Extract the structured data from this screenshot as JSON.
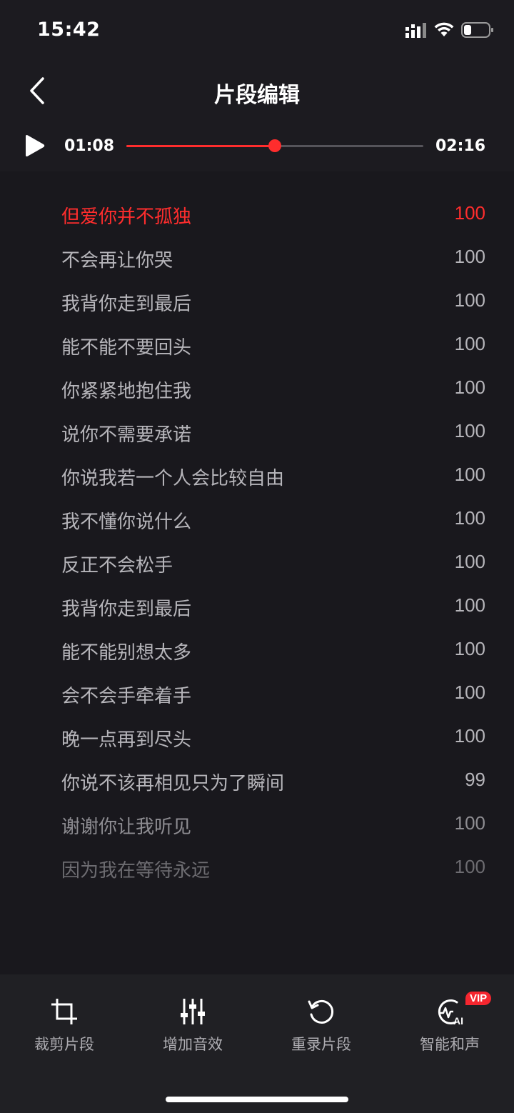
{
  "status_bar": {
    "time": "15:42",
    "signal_icon": "cellular-signal-icon",
    "wifi_icon": "wifi-icon",
    "battery_icon": "battery-icon"
  },
  "header": {
    "title": "片段编辑",
    "back_icon": "chevron-left-icon"
  },
  "player": {
    "play_icon": "play-icon",
    "current_time": "01:08",
    "total_time": "02:16",
    "progress": 0.5,
    "accent_color": "#ff2d2d"
  },
  "lyrics": [
    {
      "text": "但爱你并不孤独",
      "score": "100"
    },
    {
      "text": "不会再让你哭",
      "score": "100"
    },
    {
      "text": "我背你走到最后",
      "score": "100"
    },
    {
      "text": "能不能不要回头",
      "score": "100"
    },
    {
      "text": "你紧紧地抱住我",
      "score": "100"
    },
    {
      "text": "说你不需要承诺",
      "score": "100"
    },
    {
      "text": "你说我若一个人会比较自由",
      "score": "100"
    },
    {
      "text": "我不懂你说什么",
      "score": "100"
    },
    {
      "text": "反正不会松手",
      "score": "100"
    },
    {
      "text": "我背你走到最后",
      "score": "100"
    },
    {
      "text": "能不能别想太多",
      "score": "100"
    },
    {
      "text": "会不会手牵着手",
      "score": "100"
    },
    {
      "text": "晚一点再到尽头",
      "score": "100"
    },
    {
      "text": "你说不该再相见只为了瞬间",
      "score": "99"
    },
    {
      "text": "谢谢你让我听见",
      "score": "100"
    },
    {
      "text": "因为我在等待永远",
      "score": "100"
    }
  ],
  "toolbar": {
    "items": [
      {
        "label": "裁剪片段",
        "icon": "crop-icon"
      },
      {
        "label": "增加音效",
        "icon": "sliders-icon"
      },
      {
        "label": "重录片段",
        "icon": "rerecord-icon"
      },
      {
        "label": "智能和声",
        "icon": "ai-harmony-icon",
        "badge": "VIP"
      }
    ]
  }
}
